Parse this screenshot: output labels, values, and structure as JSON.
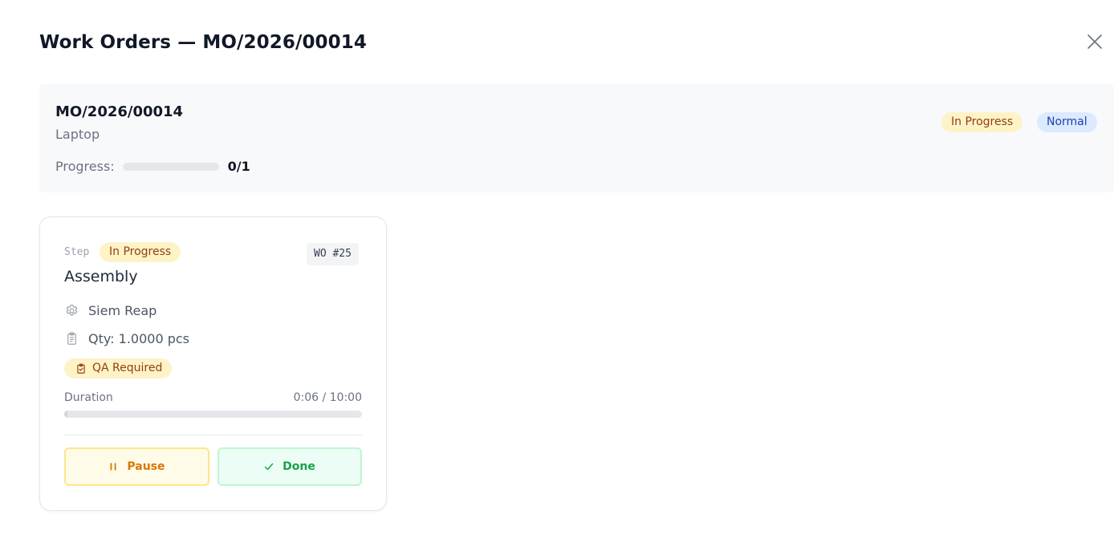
{
  "modal": {
    "title": "Work Orders — MO/2026/00014",
    "close_icon": "close-icon"
  },
  "summary": {
    "code": "MO/2026/00014",
    "product": "Laptop",
    "progress_label": "Progress:",
    "progress_done": 0,
    "progress_total": 1,
    "progress_text": "0/1",
    "status": "In Progress",
    "priority": "Normal"
  },
  "work_order": {
    "step_label": "Step",
    "state": "In Progress",
    "number": "WO #25",
    "name": "Assembly",
    "workcenter": "Siem Reap",
    "workcenter_icon": "gear-icon",
    "quantity": "Qty: 1.0000 pcs",
    "quantity_icon": "clipboard-icon",
    "qa_label": "QA Required",
    "qa_icon": "clipboard-check-icon",
    "duration_label": "Duration",
    "duration_value": "0:06 / 10:00",
    "duration_fraction": 0.01,
    "actions": {
      "pause_label": "Pause",
      "pause_icon": "pause-icon",
      "done_label": "Done",
      "done_icon": "check-icon"
    }
  },
  "colors": {
    "status_bg": "#fef3c7",
    "status_text": "#92400e",
    "priority_bg": "#dbeafe",
    "priority_text": "#1e40af",
    "pause": "#d97706",
    "done": "#16a34a"
  }
}
